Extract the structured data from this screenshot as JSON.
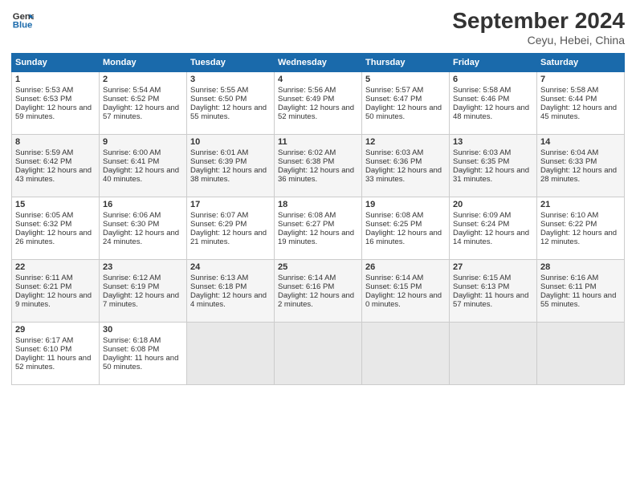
{
  "logo": {
    "line1": "General",
    "line2": "Blue"
  },
  "title": "September 2024",
  "location": "Ceyu, Hebei, China",
  "headers": [
    "Sunday",
    "Monday",
    "Tuesday",
    "Wednesday",
    "Thursday",
    "Friday",
    "Saturday"
  ],
  "weeks": [
    [
      {
        "day": "1",
        "rise": "Sunrise: 5:53 AM",
        "set": "Sunset: 6:53 PM",
        "daylight": "Daylight: 12 hours and 59 minutes."
      },
      {
        "day": "2",
        "rise": "Sunrise: 5:54 AM",
        "set": "Sunset: 6:52 PM",
        "daylight": "Daylight: 12 hours and 57 minutes."
      },
      {
        "day": "3",
        "rise": "Sunrise: 5:55 AM",
        "set": "Sunset: 6:50 PM",
        "daylight": "Daylight: 12 hours and 55 minutes."
      },
      {
        "day": "4",
        "rise": "Sunrise: 5:56 AM",
        "set": "Sunset: 6:49 PM",
        "daylight": "Daylight: 12 hours and 52 minutes."
      },
      {
        "day": "5",
        "rise": "Sunrise: 5:57 AM",
        "set": "Sunset: 6:47 PM",
        "daylight": "Daylight: 12 hours and 50 minutes."
      },
      {
        "day": "6",
        "rise": "Sunrise: 5:58 AM",
        "set": "Sunset: 6:46 PM",
        "daylight": "Daylight: 12 hours and 48 minutes."
      },
      {
        "day": "7",
        "rise": "Sunrise: 5:58 AM",
        "set": "Sunset: 6:44 PM",
        "daylight": "Daylight: 12 hours and 45 minutes."
      }
    ],
    [
      {
        "day": "8",
        "rise": "Sunrise: 5:59 AM",
        "set": "Sunset: 6:42 PM",
        "daylight": "Daylight: 12 hours and 43 minutes."
      },
      {
        "day": "9",
        "rise": "Sunrise: 6:00 AM",
        "set": "Sunset: 6:41 PM",
        "daylight": "Daylight: 12 hours and 40 minutes."
      },
      {
        "day": "10",
        "rise": "Sunrise: 6:01 AM",
        "set": "Sunset: 6:39 PM",
        "daylight": "Daylight: 12 hours and 38 minutes."
      },
      {
        "day": "11",
        "rise": "Sunrise: 6:02 AM",
        "set": "Sunset: 6:38 PM",
        "daylight": "Daylight: 12 hours and 36 minutes."
      },
      {
        "day": "12",
        "rise": "Sunrise: 6:03 AM",
        "set": "Sunset: 6:36 PM",
        "daylight": "Daylight: 12 hours and 33 minutes."
      },
      {
        "day": "13",
        "rise": "Sunrise: 6:03 AM",
        "set": "Sunset: 6:35 PM",
        "daylight": "Daylight: 12 hours and 31 minutes."
      },
      {
        "day": "14",
        "rise": "Sunrise: 6:04 AM",
        "set": "Sunset: 6:33 PM",
        "daylight": "Daylight: 12 hours and 28 minutes."
      }
    ],
    [
      {
        "day": "15",
        "rise": "Sunrise: 6:05 AM",
        "set": "Sunset: 6:32 PM",
        "daylight": "Daylight: 12 hours and 26 minutes."
      },
      {
        "day": "16",
        "rise": "Sunrise: 6:06 AM",
        "set": "Sunset: 6:30 PM",
        "daylight": "Daylight: 12 hours and 24 minutes."
      },
      {
        "day": "17",
        "rise": "Sunrise: 6:07 AM",
        "set": "Sunset: 6:29 PM",
        "daylight": "Daylight: 12 hours and 21 minutes."
      },
      {
        "day": "18",
        "rise": "Sunrise: 6:08 AM",
        "set": "Sunset: 6:27 PM",
        "daylight": "Daylight: 12 hours and 19 minutes."
      },
      {
        "day": "19",
        "rise": "Sunrise: 6:08 AM",
        "set": "Sunset: 6:25 PM",
        "daylight": "Daylight: 12 hours and 16 minutes."
      },
      {
        "day": "20",
        "rise": "Sunrise: 6:09 AM",
        "set": "Sunset: 6:24 PM",
        "daylight": "Daylight: 12 hours and 14 minutes."
      },
      {
        "day": "21",
        "rise": "Sunrise: 6:10 AM",
        "set": "Sunset: 6:22 PM",
        "daylight": "Daylight: 12 hours and 12 minutes."
      }
    ],
    [
      {
        "day": "22",
        "rise": "Sunrise: 6:11 AM",
        "set": "Sunset: 6:21 PM",
        "daylight": "Daylight: 12 hours and 9 minutes."
      },
      {
        "day": "23",
        "rise": "Sunrise: 6:12 AM",
        "set": "Sunset: 6:19 PM",
        "daylight": "Daylight: 12 hours and 7 minutes."
      },
      {
        "day": "24",
        "rise": "Sunrise: 6:13 AM",
        "set": "Sunset: 6:18 PM",
        "daylight": "Daylight: 12 hours and 4 minutes."
      },
      {
        "day": "25",
        "rise": "Sunrise: 6:14 AM",
        "set": "Sunset: 6:16 PM",
        "daylight": "Daylight: 12 hours and 2 minutes."
      },
      {
        "day": "26",
        "rise": "Sunrise: 6:14 AM",
        "set": "Sunset: 6:15 PM",
        "daylight": "Daylight: 12 hours and 0 minutes."
      },
      {
        "day": "27",
        "rise": "Sunrise: 6:15 AM",
        "set": "Sunset: 6:13 PM",
        "daylight": "Daylight: 11 hours and 57 minutes."
      },
      {
        "day": "28",
        "rise": "Sunrise: 6:16 AM",
        "set": "Sunset: 6:11 PM",
        "daylight": "Daylight: 11 hours and 55 minutes."
      }
    ],
    [
      {
        "day": "29",
        "rise": "Sunrise: 6:17 AM",
        "set": "Sunset: 6:10 PM",
        "daylight": "Daylight: 11 hours and 52 minutes."
      },
      {
        "day": "30",
        "rise": "Sunrise: 6:18 AM",
        "set": "Sunset: 6:08 PM",
        "daylight": "Daylight: 11 hours and 50 minutes."
      },
      null,
      null,
      null,
      null,
      null
    ]
  ]
}
